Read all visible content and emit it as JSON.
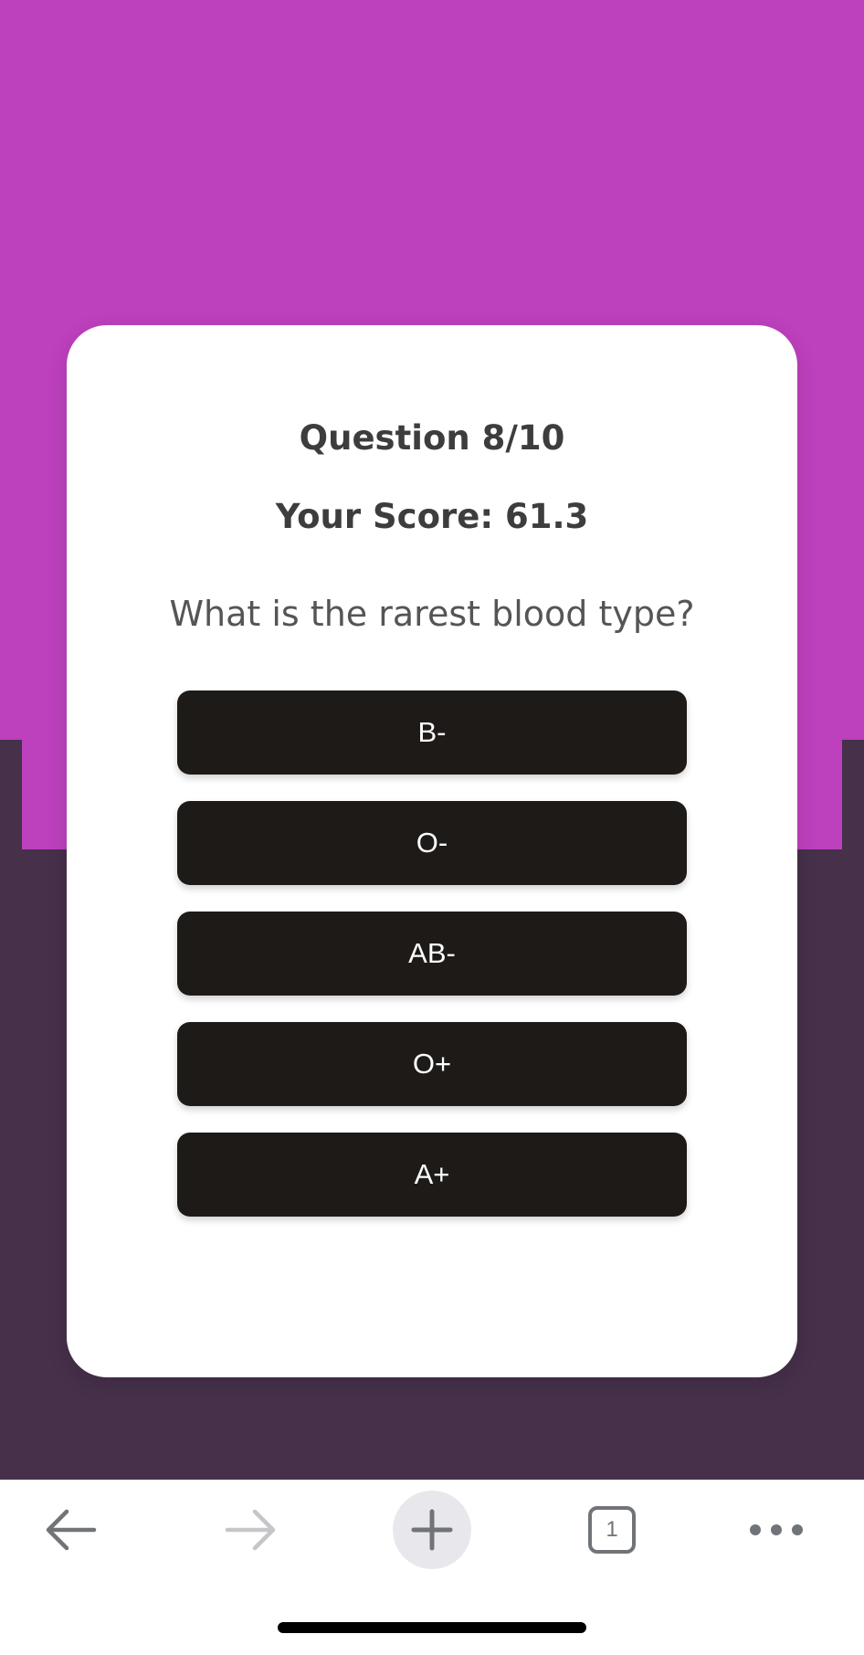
{
  "quiz": {
    "question_number": "Question 8/10",
    "score": "Your Score: 61.3",
    "question": "What is the rarest blood type?",
    "answers": [
      "B-",
      "O-",
      "AB-",
      "O+",
      "A+"
    ]
  },
  "browser": {
    "tab_count": "1"
  },
  "colors": {
    "accent": "#bd40bd",
    "background_dark": "#46304a",
    "button": "#1e1a18",
    "card": "#ffffff"
  },
  "icons": {
    "back": "arrow-left-icon",
    "forward": "arrow-right-icon",
    "new_tab": "plus-icon",
    "tabs": "tab-count-icon",
    "menu": "more-dots-icon"
  }
}
